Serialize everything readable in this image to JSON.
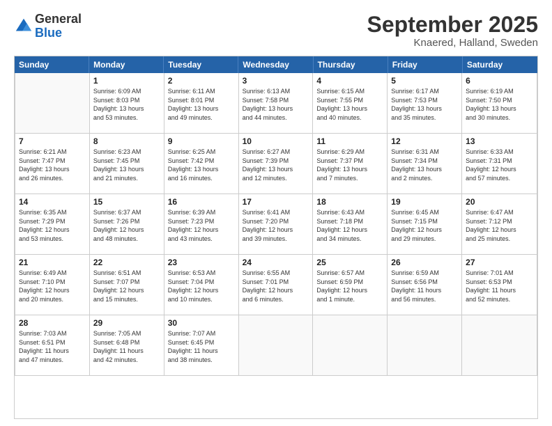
{
  "logo": {
    "general": "General",
    "blue": "Blue"
  },
  "header": {
    "month": "September 2025",
    "location": "Knaered, Halland, Sweden"
  },
  "days": [
    "Sunday",
    "Monday",
    "Tuesday",
    "Wednesday",
    "Thursday",
    "Friday",
    "Saturday"
  ],
  "weeks": [
    [
      {
        "num": "",
        "info": ""
      },
      {
        "num": "1",
        "info": "Sunrise: 6:09 AM\nSunset: 8:03 PM\nDaylight: 13 hours\nand 53 minutes."
      },
      {
        "num": "2",
        "info": "Sunrise: 6:11 AM\nSunset: 8:01 PM\nDaylight: 13 hours\nand 49 minutes."
      },
      {
        "num": "3",
        "info": "Sunrise: 6:13 AM\nSunset: 7:58 PM\nDaylight: 13 hours\nand 44 minutes."
      },
      {
        "num": "4",
        "info": "Sunrise: 6:15 AM\nSunset: 7:55 PM\nDaylight: 13 hours\nand 40 minutes."
      },
      {
        "num": "5",
        "info": "Sunrise: 6:17 AM\nSunset: 7:53 PM\nDaylight: 13 hours\nand 35 minutes."
      },
      {
        "num": "6",
        "info": "Sunrise: 6:19 AM\nSunset: 7:50 PM\nDaylight: 13 hours\nand 30 minutes."
      }
    ],
    [
      {
        "num": "7",
        "info": "Sunrise: 6:21 AM\nSunset: 7:47 PM\nDaylight: 13 hours\nand 26 minutes."
      },
      {
        "num": "8",
        "info": "Sunrise: 6:23 AM\nSunset: 7:45 PM\nDaylight: 13 hours\nand 21 minutes."
      },
      {
        "num": "9",
        "info": "Sunrise: 6:25 AM\nSunset: 7:42 PM\nDaylight: 13 hours\nand 16 minutes."
      },
      {
        "num": "10",
        "info": "Sunrise: 6:27 AM\nSunset: 7:39 PM\nDaylight: 13 hours\nand 12 minutes."
      },
      {
        "num": "11",
        "info": "Sunrise: 6:29 AM\nSunset: 7:37 PM\nDaylight: 13 hours\nand 7 minutes."
      },
      {
        "num": "12",
        "info": "Sunrise: 6:31 AM\nSunset: 7:34 PM\nDaylight: 13 hours\nand 2 minutes."
      },
      {
        "num": "13",
        "info": "Sunrise: 6:33 AM\nSunset: 7:31 PM\nDaylight: 12 hours\nand 57 minutes."
      }
    ],
    [
      {
        "num": "14",
        "info": "Sunrise: 6:35 AM\nSunset: 7:29 PM\nDaylight: 12 hours\nand 53 minutes."
      },
      {
        "num": "15",
        "info": "Sunrise: 6:37 AM\nSunset: 7:26 PM\nDaylight: 12 hours\nand 48 minutes."
      },
      {
        "num": "16",
        "info": "Sunrise: 6:39 AM\nSunset: 7:23 PM\nDaylight: 12 hours\nand 43 minutes."
      },
      {
        "num": "17",
        "info": "Sunrise: 6:41 AM\nSunset: 7:20 PM\nDaylight: 12 hours\nand 39 minutes."
      },
      {
        "num": "18",
        "info": "Sunrise: 6:43 AM\nSunset: 7:18 PM\nDaylight: 12 hours\nand 34 minutes."
      },
      {
        "num": "19",
        "info": "Sunrise: 6:45 AM\nSunset: 7:15 PM\nDaylight: 12 hours\nand 29 minutes."
      },
      {
        "num": "20",
        "info": "Sunrise: 6:47 AM\nSunset: 7:12 PM\nDaylight: 12 hours\nand 25 minutes."
      }
    ],
    [
      {
        "num": "21",
        "info": "Sunrise: 6:49 AM\nSunset: 7:10 PM\nDaylight: 12 hours\nand 20 minutes."
      },
      {
        "num": "22",
        "info": "Sunrise: 6:51 AM\nSunset: 7:07 PM\nDaylight: 12 hours\nand 15 minutes."
      },
      {
        "num": "23",
        "info": "Sunrise: 6:53 AM\nSunset: 7:04 PM\nDaylight: 12 hours\nand 10 minutes."
      },
      {
        "num": "24",
        "info": "Sunrise: 6:55 AM\nSunset: 7:01 PM\nDaylight: 12 hours\nand 6 minutes."
      },
      {
        "num": "25",
        "info": "Sunrise: 6:57 AM\nSunset: 6:59 PM\nDaylight: 12 hours\nand 1 minute."
      },
      {
        "num": "26",
        "info": "Sunrise: 6:59 AM\nSunset: 6:56 PM\nDaylight: 11 hours\nand 56 minutes."
      },
      {
        "num": "27",
        "info": "Sunrise: 7:01 AM\nSunset: 6:53 PM\nDaylight: 11 hours\nand 52 minutes."
      }
    ],
    [
      {
        "num": "28",
        "info": "Sunrise: 7:03 AM\nSunset: 6:51 PM\nDaylight: 11 hours\nand 47 minutes."
      },
      {
        "num": "29",
        "info": "Sunrise: 7:05 AM\nSunset: 6:48 PM\nDaylight: 11 hours\nand 42 minutes."
      },
      {
        "num": "30",
        "info": "Sunrise: 7:07 AM\nSunset: 6:45 PM\nDaylight: 11 hours\nand 38 minutes."
      },
      {
        "num": "",
        "info": ""
      },
      {
        "num": "",
        "info": ""
      },
      {
        "num": "",
        "info": ""
      },
      {
        "num": "",
        "info": ""
      }
    ]
  ]
}
